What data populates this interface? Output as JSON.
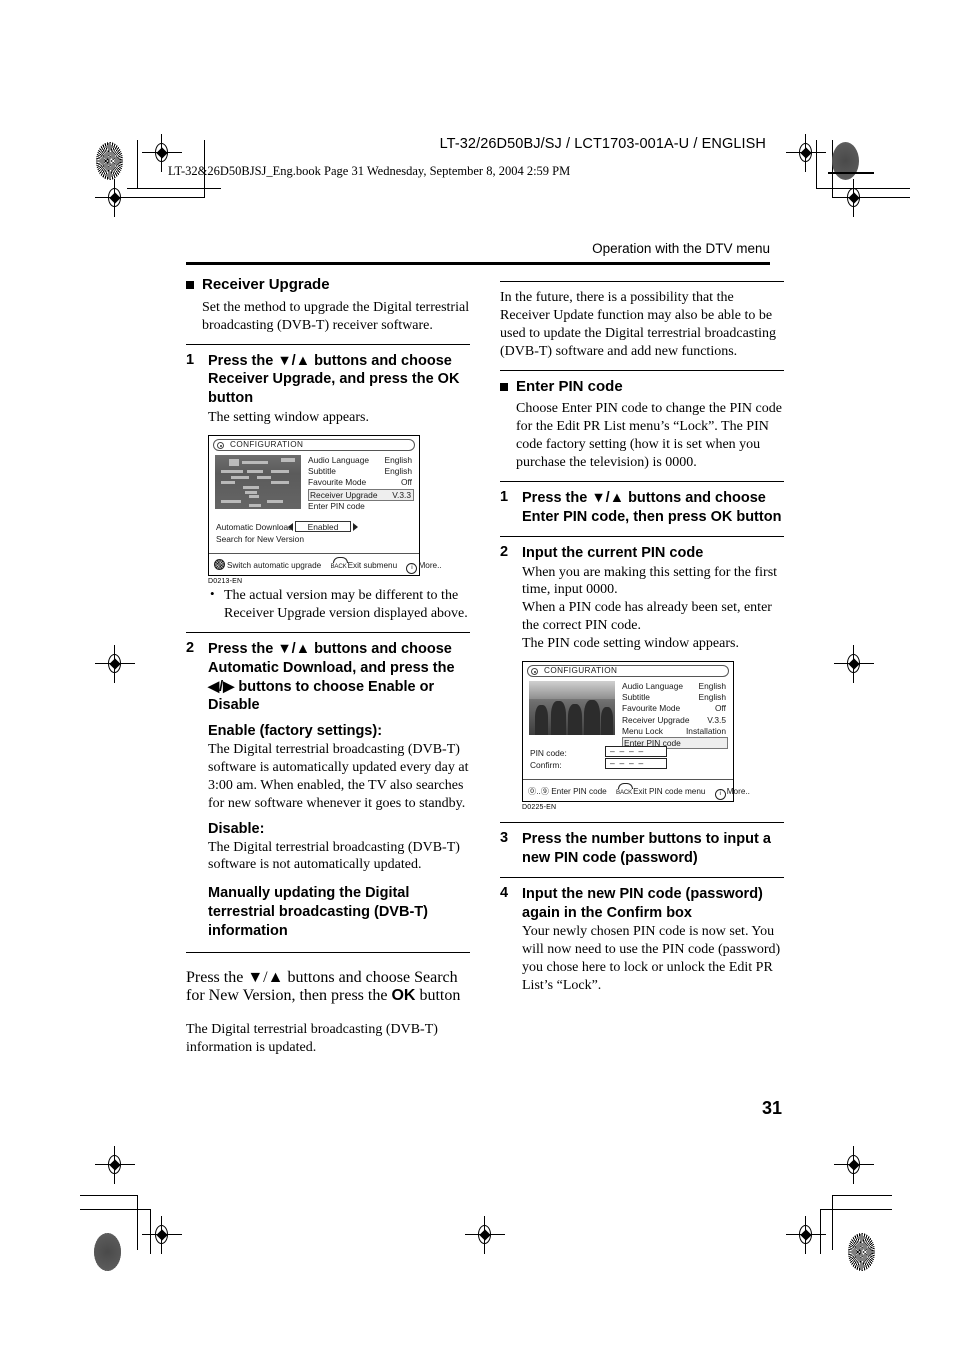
{
  "header": {
    "doc_code": "LT-32/26D50BJ/SJ / LCT1703-001A-U / ENGLISH",
    "book_line": "LT-32&26D50BJSJ_Eng.book  Page 31  Wednesday, September 8, 2004  2:59 PM"
  },
  "running_head": "Operation with the DTV menu",
  "page_number": "31",
  "left_column": {
    "section_title": "Receiver Upgrade",
    "intro": "Set the method to upgrade the Digital terrestrial broadcasting (DVB-T) receiver software.",
    "step1": {
      "num": "1",
      "head": "Press the ▼/▲ buttons and choose Receiver Upgrade, and press the OK button",
      "head_a": "Press the ▼/▲ buttons and choose Receiver Upgrade, and press the ",
      "head_ok": "OK",
      "head_b": " button",
      "body": "The setting window appears."
    },
    "note_bullet": "The actual version may be different to the Receiver Upgrade version displayed above.",
    "step2": {
      "num": "2",
      "head": "Press the ▼/▲ buttons and choose Automatic Download, and press the ◀/▶ buttons to choose Enable or Disable",
      "enable_head": "Enable (factory settings):",
      "enable_body": "The Digital terrestrial broadcasting (DVB-T) software is automatically updated every day at 3:00 am. When enabled, the TV also searches for new software whenever it goes to standby.",
      "disable_head": "Disable:",
      "disable_body": "The Digital terrestrial broadcasting (DVB-T) software is not automatically updated."
    },
    "manual_head": "Manually updating the Digital terrestrial broadcasting (DVB-T) information",
    "manual_step": {
      "head_a": "Press the ▼/▲ buttons and choose Search for New Version, then press the ",
      "head_ok": "OK",
      "head_b": " button",
      "body": "The Digital terrestrial broadcasting (DVB-T) information is updated."
    }
  },
  "right_column": {
    "future_note": "In the future, there is a possibility that the Receiver Update function may also be able to be used to update the Digital terrestrial broadcasting (DVB-T) software and add new functions.",
    "section_title": "Enter PIN code",
    "intro": "Choose Enter PIN code to change the PIN code for the Edit PR List menu’s “Lock”. The PIN code factory setting (how it is set when you purchase the television) is 0000.",
    "step1": {
      "num": "1",
      "head_a": "Press the ▼/▲ buttons and choose Enter PIN code, then press ",
      "head_ok": "OK",
      "head_b": " button"
    },
    "step2": {
      "num": "2",
      "head": "Input the current PIN code",
      "body": "When you are making this setting for the first time, input 0000.\nWhen a PIN code has already been set, enter the correct PIN code.\nThe PIN code setting window appears."
    },
    "step3": {
      "num": "3",
      "head": "Press the number buttons to input a new PIN code (password)"
    },
    "step4": {
      "num": "4",
      "head": "Input the new PIN code (password) again in the Confirm box",
      "body": "Your newly chosen PIN code is now set. You will now need to use the PIN code (password) you chose here to lock or unlock the Edit PR List’s “Lock”."
    }
  },
  "osd1": {
    "title": "CONFIGURATION",
    "menu": [
      {
        "label": "Audio Language",
        "value": "English",
        "selected": false
      },
      {
        "label": "Subtitle",
        "value": "English",
        "selected": false
      },
      {
        "label": "Favourite Mode",
        "value": "Off",
        "selected": false
      },
      {
        "label": "Receiver Upgrade",
        "value": "V.3.3",
        "selected": true
      },
      {
        "label": "Enter PIN code",
        "value": "",
        "selected": false
      }
    ],
    "auto_download_label": "Automatic Download",
    "auto_download_value": "Enabled",
    "search_label": "Search for New Version",
    "footer": [
      {
        "icon": "wheel-icon",
        "text": "Switch automatic upgrade"
      },
      {
        "icon": "back-icon",
        "text": "Exit submenu"
      },
      {
        "icon": "info-icon",
        "text": "More.."
      }
    ],
    "figure_code": "D0213-EN"
  },
  "osd2": {
    "title": "CONFIGURATION",
    "menu": [
      {
        "label": "Audio Language",
        "value": "English",
        "selected": false
      },
      {
        "label": "Subtitle",
        "value": "English",
        "selected": false
      },
      {
        "label": "Favourite Mode",
        "value": "Off",
        "selected": false
      },
      {
        "label": "Receiver Upgrade",
        "value": "V.3.5",
        "selected": false
      },
      {
        "label": "Menu Lock",
        "value": "Installation",
        "selected": false
      },
      {
        "label": "Enter PIN code",
        "value": "",
        "selected": true
      }
    ],
    "pin_label": "PIN code:",
    "confirm_label": "Confirm:",
    "pin_value": "– – – –",
    "confirm_value": "– – – –",
    "footer": [
      {
        "icon": "number-keys-icon",
        "prefix": "⓪..⑨",
        "text": "Enter PIN code"
      },
      {
        "icon": "back-icon",
        "text": "Exit PIN code menu"
      },
      {
        "icon": "info-icon",
        "text": "More.."
      }
    ],
    "figure_code": "D0225-EN"
  }
}
